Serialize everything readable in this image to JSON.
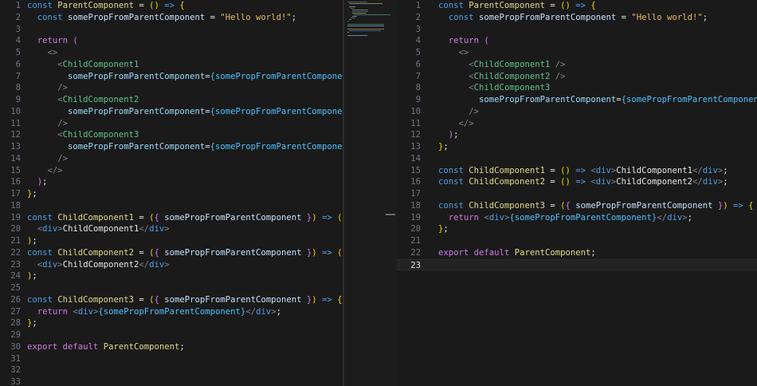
{
  "theme": {
    "background": "#1a1a1a",
    "keyword": "#4f9fe8",
    "function": "#e5d88b",
    "string": "#e8b86b",
    "tag": "#5fc38a",
    "bracket_gold": "#f1d700",
    "bracket_purple": "#d27ae6",
    "bracket_blue": "#3c9cf0"
  },
  "left_editor": {
    "active_line": 0,
    "lines": [
      {
        "n": "1",
        "t": [
          [
            "kw",
            "const "
          ],
          [
            "fn",
            "ParentComponent"
          ],
          [
            "pc",
            " = "
          ],
          [
            "br1",
            "()"
          ],
          [
            "kw",
            " => "
          ],
          [
            "br1",
            "{"
          ]
        ]
      },
      {
        "n": "2",
        "t": [
          [
            "pc",
            "  "
          ],
          [
            "kw",
            "const "
          ],
          [
            "vr",
            "somePropFromParentComponent"
          ],
          [
            "pc",
            " = "
          ],
          [
            "st",
            "\"Hello world!\""
          ],
          [
            "pc",
            ";"
          ]
        ]
      },
      {
        "n": "3",
        "t": []
      },
      {
        "n": "4",
        "t": [
          [
            "pc",
            "  "
          ],
          [
            "br2",
            "return "
          ],
          [
            "br2",
            "("
          ]
        ]
      },
      {
        "n": "5",
        "t": [
          [
            "pc",
            "    "
          ],
          [
            "tb",
            "<>"
          ]
        ]
      },
      {
        "n": "6",
        "t": [
          [
            "pc",
            "      "
          ],
          [
            "tb",
            "<"
          ],
          [
            "tg",
            "ChildComponent1"
          ]
        ]
      },
      {
        "n": "7",
        "t": [
          [
            "pc",
            "        "
          ],
          [
            "at",
            "somePropFromParentComponent"
          ],
          [
            "pc",
            "="
          ],
          [
            "ex",
            "{somePropFromParentComponent}"
          ]
        ]
      },
      {
        "n": "8",
        "t": [
          [
            "pc",
            "      "
          ],
          [
            "tb",
            "/>"
          ]
        ]
      },
      {
        "n": "9",
        "t": [
          [
            "pc",
            "      "
          ],
          [
            "tb",
            "<"
          ],
          [
            "tg",
            "ChildComponent2"
          ]
        ]
      },
      {
        "n": "10",
        "t": [
          [
            "pc",
            "        "
          ],
          [
            "at",
            "somePropFromParentComponent"
          ],
          [
            "pc",
            "="
          ],
          [
            "ex",
            "{somePropFromParentComponent}"
          ]
        ]
      },
      {
        "n": "11",
        "t": [
          [
            "pc",
            "      "
          ],
          [
            "tb",
            "/>"
          ]
        ]
      },
      {
        "n": "12",
        "t": [
          [
            "pc",
            "      "
          ],
          [
            "tb",
            "<"
          ],
          [
            "tg",
            "ChildComponent3"
          ]
        ]
      },
      {
        "n": "13",
        "t": [
          [
            "pc",
            "        "
          ],
          [
            "at",
            "somePropFromParentComponent"
          ],
          [
            "pc",
            "="
          ],
          [
            "ex",
            "{somePropFromParentComponent}"
          ]
        ]
      },
      {
        "n": "14",
        "t": [
          [
            "pc",
            "      "
          ],
          [
            "tb",
            "/>"
          ]
        ]
      },
      {
        "n": "15",
        "t": [
          [
            "pc",
            "    "
          ],
          [
            "tb",
            "</>"
          ]
        ]
      },
      {
        "n": "16",
        "t": [
          [
            "pc",
            "  "
          ],
          [
            "br2",
            ")"
          ],
          [
            "pc",
            ";"
          ]
        ]
      },
      {
        "n": "17",
        "t": [
          [
            "br1",
            "}"
          ],
          [
            "pc",
            ";"
          ]
        ]
      },
      {
        "n": "18",
        "t": []
      },
      {
        "n": "19",
        "t": [
          [
            "kw",
            "const "
          ],
          [
            "fn",
            "ChildComponent1"
          ],
          [
            "pc",
            " = "
          ],
          [
            "br1",
            "("
          ],
          [
            "br2",
            "{ "
          ],
          [
            "vr",
            "somePropFromParentComponent"
          ],
          [
            "br2",
            " }"
          ],
          [
            "br1",
            ")"
          ],
          [
            "kw",
            " => "
          ],
          [
            "br1",
            "("
          ]
        ]
      },
      {
        "n": "20",
        "t": [
          [
            "pc",
            "  "
          ],
          [
            "tb",
            "<"
          ],
          [
            "kw",
            "div"
          ],
          [
            "tb",
            ">"
          ],
          [
            "pl",
            "ChildComponent1"
          ],
          [
            "tb",
            "</"
          ],
          [
            "kw",
            "div"
          ],
          [
            "tb",
            ">"
          ]
        ]
      },
      {
        "n": "21",
        "t": [
          [
            "br1",
            ")"
          ],
          [
            "pc",
            ";"
          ]
        ]
      },
      {
        "n": "22",
        "t": [
          [
            "kw",
            "const "
          ],
          [
            "fn",
            "ChildComponent2"
          ],
          [
            "pc",
            " = "
          ],
          [
            "br1",
            "("
          ],
          [
            "br2",
            "{ "
          ],
          [
            "vr",
            "somePropFromParentComponent"
          ],
          [
            "br2",
            " }"
          ],
          [
            "br1",
            ")"
          ],
          [
            "kw",
            " => "
          ],
          [
            "br1",
            "("
          ]
        ]
      },
      {
        "n": "23",
        "t": [
          [
            "pc",
            "  "
          ],
          [
            "tb",
            "<"
          ],
          [
            "kw",
            "div"
          ],
          [
            "tb",
            ">"
          ],
          [
            "pl",
            "ChildComponent2"
          ],
          [
            "tb",
            "</"
          ],
          [
            "kw",
            "div"
          ],
          [
            "tb",
            ">"
          ]
        ]
      },
      {
        "n": "24",
        "t": [
          [
            "br1",
            ")"
          ],
          [
            "pc",
            ";"
          ]
        ]
      },
      {
        "n": "25",
        "t": []
      },
      {
        "n": "26",
        "t": [
          [
            "kw",
            "const "
          ],
          [
            "fn",
            "ChildComponent3"
          ],
          [
            "pc",
            " = "
          ],
          [
            "br1",
            "("
          ],
          [
            "br2",
            "{ "
          ],
          [
            "vr",
            "somePropFromParentComponent"
          ],
          [
            "br2",
            " }"
          ],
          [
            "br1",
            ")"
          ],
          [
            "kw",
            " => "
          ],
          [
            "br1",
            "{"
          ]
        ]
      },
      {
        "n": "27",
        "t": [
          [
            "pc",
            "  "
          ],
          [
            "br2",
            "return "
          ],
          [
            "tb",
            "<"
          ],
          [
            "kw",
            "div"
          ],
          [
            "tb",
            ">"
          ],
          [
            "ex",
            "{somePropFromParentComponent}"
          ],
          [
            "tb",
            "</"
          ],
          [
            "kw",
            "div"
          ],
          [
            "tb",
            ">"
          ],
          [
            "pc",
            ";"
          ]
        ]
      },
      {
        "n": "28",
        "t": [
          [
            "br1",
            "}"
          ],
          [
            "pc",
            ";"
          ]
        ]
      },
      {
        "n": "29",
        "t": []
      },
      {
        "n": "30",
        "t": [
          [
            "br2",
            "export "
          ],
          [
            "br2",
            "default "
          ],
          [
            "fn",
            "ParentComponent"
          ],
          [
            "pc",
            ";"
          ]
        ]
      },
      {
        "n": "31",
        "t": []
      },
      {
        "n": "32",
        "t": []
      },
      {
        "n": "33",
        "t": []
      }
    ]
  },
  "right_editor": {
    "active_line": 23,
    "lines": [
      {
        "n": "1",
        "t": [
          [
            "kw",
            "const "
          ],
          [
            "fn",
            "ParentComponent"
          ],
          [
            "pc",
            " = "
          ],
          [
            "br1",
            "()"
          ],
          [
            "kw",
            " => "
          ],
          [
            "br1",
            "{"
          ]
        ]
      },
      {
        "n": "2",
        "t": [
          [
            "pc",
            "  "
          ],
          [
            "kw",
            "const "
          ],
          [
            "vr",
            "somePropFromParentComponent"
          ],
          [
            "pc",
            " = "
          ],
          [
            "st",
            "\"Hello world!\""
          ],
          [
            "pc",
            ";"
          ]
        ]
      },
      {
        "n": "3",
        "t": []
      },
      {
        "n": "4",
        "t": [
          [
            "pc",
            "  "
          ],
          [
            "br2",
            "return "
          ],
          [
            "br2",
            "("
          ]
        ]
      },
      {
        "n": "5",
        "t": [
          [
            "pc",
            "    "
          ],
          [
            "tb",
            "<>"
          ]
        ]
      },
      {
        "n": "6",
        "t": [
          [
            "pc",
            "      "
          ],
          [
            "tb",
            "<"
          ],
          [
            "tg",
            "ChildComponent1"
          ],
          [
            "tb",
            " />"
          ]
        ]
      },
      {
        "n": "7",
        "t": [
          [
            "pc",
            "      "
          ],
          [
            "tb",
            "<"
          ],
          [
            "tg",
            "ChildComponent2"
          ],
          [
            "tb",
            " />"
          ]
        ]
      },
      {
        "n": "8",
        "t": [
          [
            "pc",
            "      "
          ],
          [
            "tb",
            "<"
          ],
          [
            "tg",
            "ChildComponent3"
          ]
        ]
      },
      {
        "n": "9",
        "t": [
          [
            "pc",
            "        "
          ],
          [
            "at",
            "somePropFromParentComponent"
          ],
          [
            "pc",
            "="
          ],
          [
            "ex",
            "{somePropFromParentComponent}"
          ]
        ]
      },
      {
        "n": "10",
        "t": [
          [
            "pc",
            "      "
          ],
          [
            "tb",
            "/>"
          ]
        ]
      },
      {
        "n": "11",
        "t": [
          [
            "pc",
            "    "
          ],
          [
            "tb",
            "</>"
          ]
        ]
      },
      {
        "n": "12",
        "t": [
          [
            "pc",
            "  "
          ],
          [
            "br2",
            ")"
          ],
          [
            "pc",
            ";"
          ]
        ]
      },
      {
        "n": "13",
        "t": [
          [
            "br1",
            "}"
          ],
          [
            "pc",
            ";"
          ]
        ]
      },
      {
        "n": "14",
        "t": []
      },
      {
        "n": "15",
        "t": [
          [
            "kw",
            "const "
          ],
          [
            "fn",
            "ChildComponent1"
          ],
          [
            "pc",
            " = "
          ],
          [
            "br1",
            "()"
          ],
          [
            "kw",
            " => "
          ],
          [
            "tb",
            "<"
          ],
          [
            "kw",
            "div"
          ],
          [
            "tb",
            ">"
          ],
          [
            "pl",
            "ChildComponent1"
          ],
          [
            "tb",
            "</"
          ],
          [
            "kw",
            "div"
          ],
          [
            "tb",
            ">"
          ],
          [
            "pc",
            ";"
          ]
        ]
      },
      {
        "n": "16",
        "t": [
          [
            "kw",
            "const "
          ],
          [
            "fn",
            "ChildComponent2"
          ],
          [
            "pc",
            " = "
          ],
          [
            "br1",
            "()"
          ],
          [
            "kw",
            " => "
          ],
          [
            "tb",
            "<"
          ],
          [
            "kw",
            "div"
          ],
          [
            "tb",
            ">"
          ],
          [
            "pl",
            "ChildComponent2"
          ],
          [
            "tb",
            "</"
          ],
          [
            "kw",
            "div"
          ],
          [
            "tb",
            ">"
          ],
          [
            "pc",
            ";"
          ]
        ]
      },
      {
        "n": "17",
        "t": []
      },
      {
        "n": "18",
        "t": [
          [
            "kw",
            "const "
          ],
          [
            "fn",
            "ChildComponent3"
          ],
          [
            "pc",
            " = "
          ],
          [
            "br1",
            "("
          ],
          [
            "br2",
            "{ "
          ],
          [
            "vr",
            "somePropFromParentComponent"
          ],
          [
            "br2",
            " }"
          ],
          [
            "br1",
            ")"
          ],
          [
            "kw",
            " => "
          ],
          [
            "br1",
            "{"
          ]
        ]
      },
      {
        "n": "19",
        "t": [
          [
            "pc",
            "  "
          ],
          [
            "br2",
            "return "
          ],
          [
            "tb",
            "<"
          ],
          [
            "kw",
            "div"
          ],
          [
            "tb",
            ">"
          ],
          [
            "ex",
            "{somePropFromParentComponent}"
          ],
          [
            "tb",
            "</"
          ],
          [
            "kw",
            "div"
          ],
          [
            "tb",
            ">"
          ],
          [
            "pc",
            ";"
          ]
        ]
      },
      {
        "n": "20",
        "t": [
          [
            "br1",
            "}"
          ],
          [
            "pc",
            ";"
          ]
        ]
      },
      {
        "n": "21",
        "t": []
      },
      {
        "n": "22",
        "t": [
          [
            "br2",
            "export "
          ],
          [
            "br2",
            "default "
          ],
          [
            "fn",
            "ParentComponent"
          ],
          [
            "pc",
            ";"
          ]
        ]
      },
      {
        "n": "23",
        "t": []
      }
    ]
  }
}
